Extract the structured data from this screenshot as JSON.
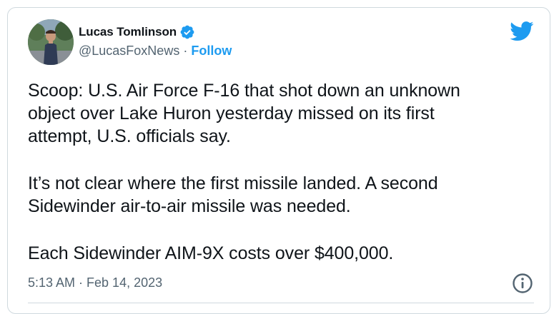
{
  "author": {
    "name": "Lucas Tomlinson",
    "handle": "@LucasFoxNews",
    "separator": " · ",
    "follow_label": "Follow",
    "verified": true
  },
  "tweet": {
    "paragraphs": [
      {
        "lines": [
          "Scoop: U.S. Air Force F-16 that shot down an unknown",
          "object over Lake Huron yesterday missed on its first",
          "attempt, U.S. officials say."
        ]
      },
      {
        "lines": [
          "It’s not clear where the first missile landed. A second",
          "Sidewinder air-to-air missile was needed."
        ]
      },
      {
        "lines": [
          "Each Sidewinder AIM-9X costs over $400,000."
        ]
      }
    ],
    "timestamp": "5:13 AM · Feb 14, 2023"
  },
  "icons": {
    "brand": "twitter-bird-icon",
    "verified": "verified-badge-icon",
    "info": "info-icon"
  },
  "colors": {
    "accent": "#1d9bf0",
    "text_primary": "#0f1419",
    "text_secondary": "#536471",
    "border": "#cfd9de"
  }
}
